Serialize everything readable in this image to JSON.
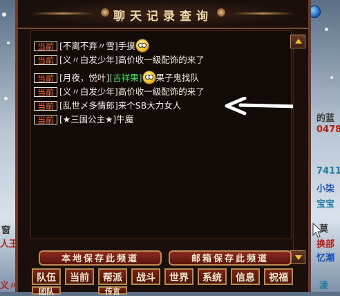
{
  "window": {
    "title": "聊天记录查询"
  },
  "chat": {
    "lines": [
      {
        "channel": "当前",
        "segments": [
          {
            "text": "[不离不弃〃雪]手摸",
            "color": "#f2eee6"
          }
        ],
        "emote": true
      },
      {
        "channel": "当前",
        "segments": [
          {
            "text": "[义〃白发少年]高价收一級配饰的来了",
            "color": "#f2eee6"
          }
        ],
        "emote": false
      },
      {
        "channel": "当前",
        "segments": [
          {
            "text": "[月夜，悦叶]",
            "color": "#f2eee6"
          },
          {
            "text": "[吉祥果]",
            "color": "#44e05c"
          }
        ],
        "emote": true,
        "after": "果子鬼找队"
      },
      {
        "channel": "当前",
        "segments": [
          {
            "text": "[义〃白发少年]高价收一級配饰的来了",
            "color": "#f2eee6"
          }
        ],
        "emote": false
      },
      {
        "channel": "当前",
        "segments": [
          {
            "text": "[乱世〆多情郎]来个SB大力女人",
            "color": "#f2eee6"
          }
        ],
        "emote": false
      },
      {
        "channel": "当前",
        "segments": [
          {
            "text": "[★三国公主★]牛魔",
            "color": "#f2eee6"
          }
        ],
        "emote": false
      }
    ]
  },
  "buttons": {
    "save_local": "本地保存此频道",
    "save_mail": "邮箱保存此频道"
  },
  "tabs": [
    "队伍",
    "当前",
    "帮派",
    "战斗",
    "世界",
    "系统",
    "信息",
    "祝福"
  ],
  "tabs_partial": [
    "团队",
    "",
    "传言"
  ],
  "background_text": {
    "right_1": "的蓝",
    "right_2": "0478",
    "right_3": "74110",
    "right_4": "小柒",
    "right_5": "宝宝",
    "right_6": "莫",
    "right_7": "换部",
    "right_8": "忆潮",
    "right_9": "凌",
    "left_1": "窗",
    "left_2": "人王",
    "left_3": "义〃"
  },
  "colors": {
    "channel_tag": "#ff6a2a",
    "item_green": "#44e05c",
    "frame": "#6b3a2a",
    "gold": "#b58b52"
  }
}
